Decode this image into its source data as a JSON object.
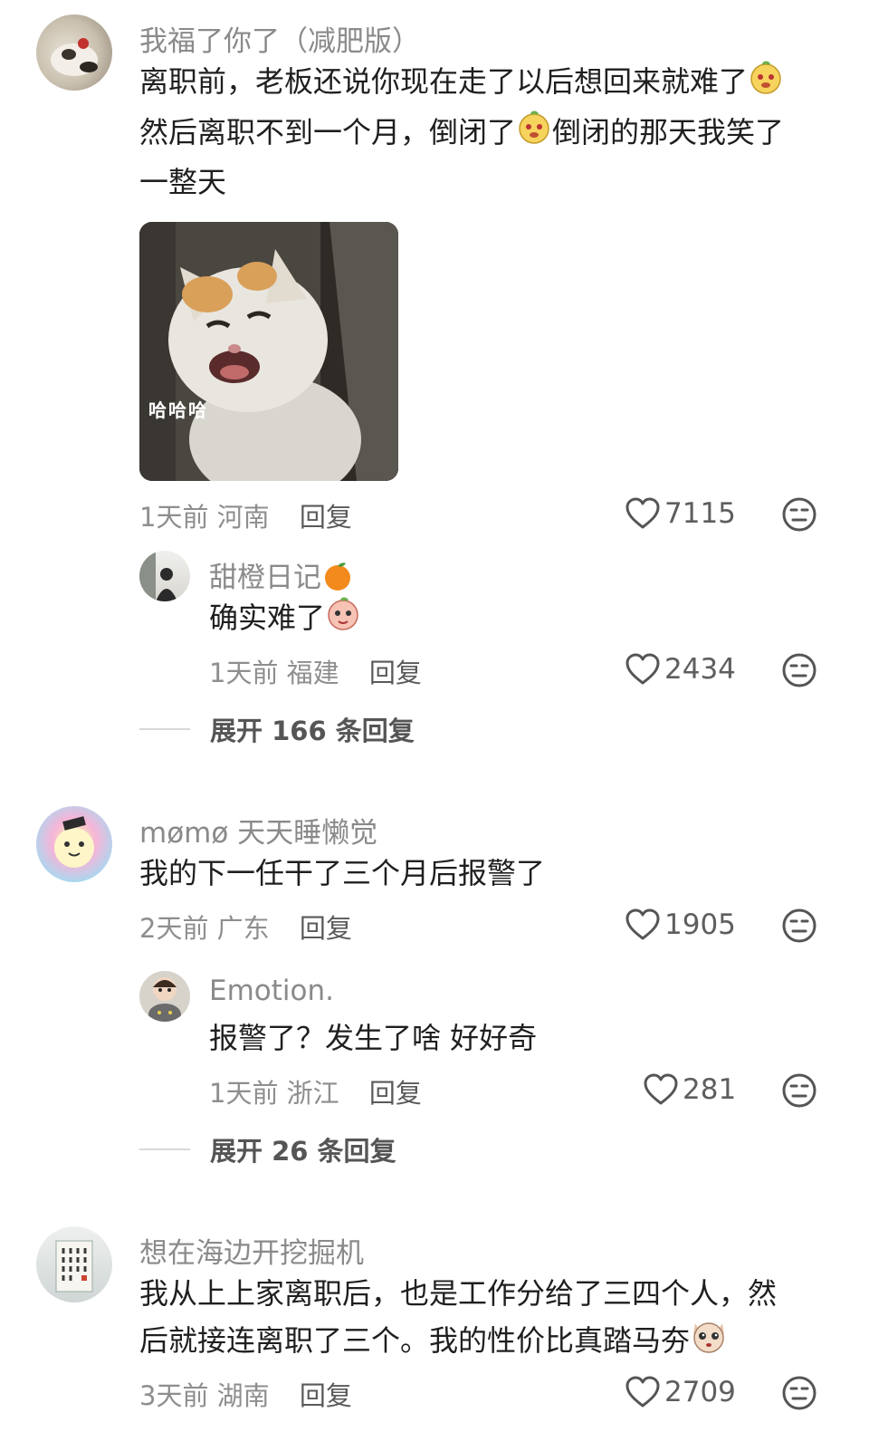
{
  "comments": [
    {
      "username": "我福了你了（减肥版）",
      "text_lines": [
        "离职前，老板还说你现在走了以后想回来就难了",
        "然后离职不到一个月，倒闭了",
        "倒闭的那天我笑了",
        "一整天"
      ],
      "image_caption": "哈哈哈",
      "time": "1天前",
      "location": "河南",
      "reply_label": "回复",
      "likes": "7115",
      "reply": {
        "username": "甜橙日记",
        "text": "确实难了",
        "time": "1天前",
        "location": "福建",
        "reply_label": "回复",
        "likes": "2434"
      },
      "expand_label": "展开 166 条回复"
    },
    {
      "username": "mømø 天天睡懒觉",
      "text": "我的下一任干了三个月后报警了",
      "time": "2天前",
      "location": "广东",
      "reply_label": "回复",
      "likes": "1905",
      "reply": {
        "username": "Emotion.",
        "text": "报警了？发生了啥 好好奇",
        "time": "1天前",
        "location": "浙江",
        "reply_label": "回复",
        "likes": "281"
      },
      "expand_label": "展开 26 条回复"
    },
    {
      "username": "想在海边开挖掘机",
      "text_lines": [
        "我从上上家离职后，也是工作分给了三四个人，然",
        "后就接连离职了三个。我的性价比真踏马夯"
      ],
      "time": "3天前",
      "location": "湖南",
      "reply_label": "回复",
      "likes": "2709"
    }
  ],
  "icons": {
    "like": "heart-outline-icon",
    "react": "neutral-face-icon"
  },
  "colors": {
    "username": "#8a8a8a",
    "text": "#1f1f1f",
    "meta": "#8e8e8e"
  }
}
